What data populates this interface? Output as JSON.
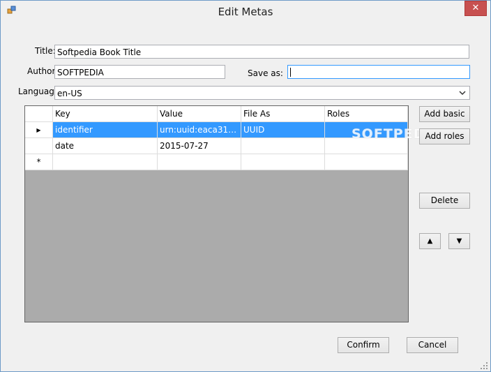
{
  "window": {
    "title": "Edit Metas",
    "close_symbol": "✕"
  },
  "form": {
    "title_label": "Title:",
    "title_value": "Softpedia Book Title",
    "author_label": "Author:",
    "author_value": "SOFTPEDIA",
    "save_as_label": "Save as:",
    "save_as_value": "",
    "language_label": "Language:",
    "language_value": "en-US"
  },
  "grid": {
    "columns": [
      "Key",
      "Value",
      "File As",
      "Roles"
    ],
    "rows": [
      {
        "indicator": "▶",
        "key": "identifier",
        "value": "urn:uuid:eaca31da-e...",
        "file_as": "UUID",
        "roles": ""
      },
      {
        "indicator": "",
        "key": "date",
        "value": "2015-07-27",
        "file_as": "",
        "roles": ""
      }
    ],
    "new_row_indicator": "*"
  },
  "side_buttons": {
    "add_basic": "Add basic",
    "add_roles": "Add roles",
    "delete": "Delete",
    "move_up": "▲",
    "move_down": "▼"
  },
  "footer": {
    "confirm": "Confirm",
    "cancel": "Cancel"
  },
  "watermark": "SOFTPEDIA",
  "colors": {
    "selection": "#3399ff",
    "grid_background": "#ababab",
    "close_button": "#c75050"
  }
}
